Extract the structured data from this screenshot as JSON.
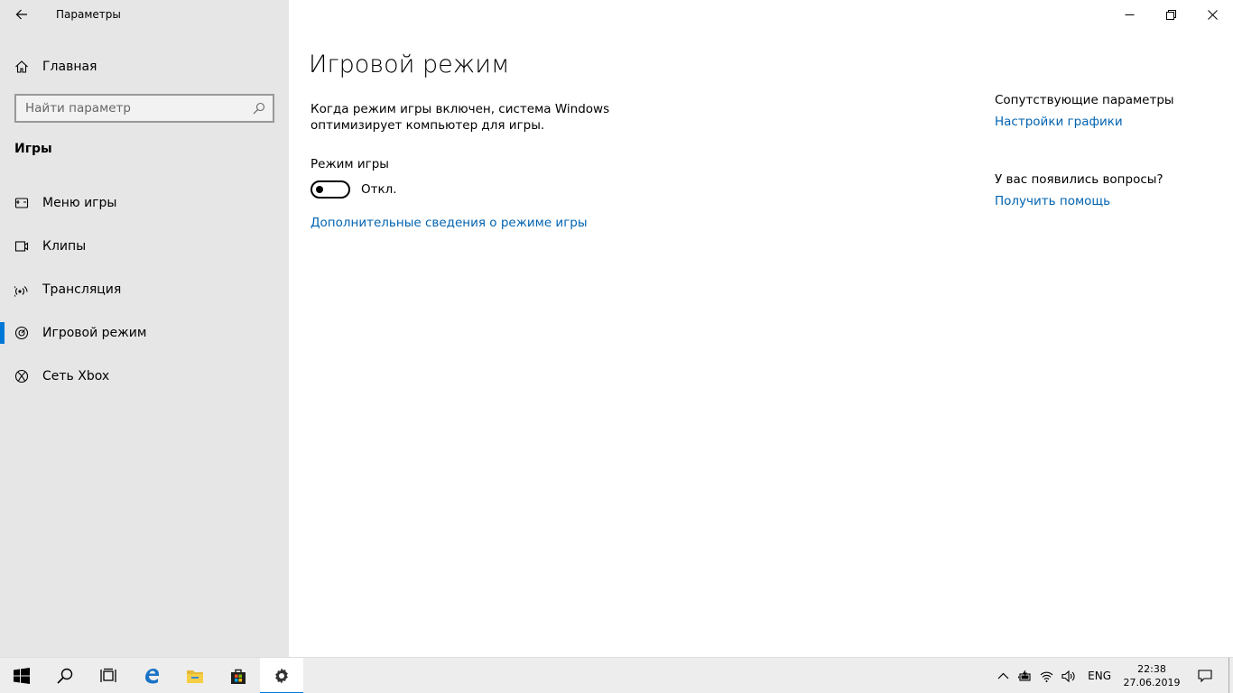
{
  "window": {
    "title": "Параметры",
    "back_icon": "back-arrow-icon",
    "controls": [
      "minimize-icon",
      "restore-icon",
      "close-icon"
    ]
  },
  "sidebar": {
    "home_label": "Главная",
    "home_icon": "home-icon",
    "search": {
      "placeholder": "Найти параметр",
      "icon": "search-icon"
    },
    "section_title": "Игры",
    "items": [
      {
        "label": "Меню игры",
        "icon": "game-bar-icon",
        "active": false
      },
      {
        "label": "Клипы",
        "icon": "captures-icon",
        "active": false
      },
      {
        "label": "Трансляция",
        "icon": "broadcast-icon",
        "active": false
      },
      {
        "label": "Игровой режим",
        "icon": "game-mode-icon",
        "active": true
      },
      {
        "label": "Сеть Xbox",
        "icon": "xbox-icon",
        "active": false
      }
    ]
  },
  "main": {
    "title": "Игровой режим",
    "description": "Когда режим игры включен, система Windows оптимизирует компьютер для игры.",
    "toggle": {
      "label": "Режим игры",
      "state_text": "Откл.",
      "on": false
    },
    "more_link": "Дополнительные сведения о режиме игры"
  },
  "related": {
    "title": "Сопутствующие параметры",
    "link": "Настройки графики",
    "questions_title": "У вас появились вопросы?",
    "help_link": "Получить помощь"
  },
  "taskbar": {
    "apps": [
      "windows-start-icon",
      "search-icon",
      "task-view-icon",
      "edge-icon",
      "file-explorer-icon",
      "store-icon",
      "settings-icon"
    ],
    "active_app": "settings-icon",
    "tray_icons": [
      "chevron-up-icon",
      "battery-icon",
      "wifi-icon",
      "volume-icon"
    ],
    "language": "ENG",
    "time": "22:38",
    "date": "27.06.2019",
    "notification_icon": "action-center-icon"
  },
  "colors": {
    "accent": "#0078d7",
    "link": "#0063b1",
    "sidebar_bg": "#e6e6e6",
    "taskbar_bg": "#ededed"
  }
}
